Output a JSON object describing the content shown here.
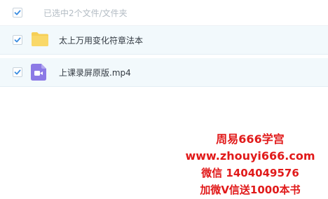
{
  "header": {
    "selection_text": "已选中2个文件/文件夹"
  },
  "files": [
    {
      "name": "太上万用变化符章法本",
      "icon": "folder-icon",
      "checked": true
    },
    {
      "name": "上课录屏原版.mp4",
      "icon": "video-icon",
      "checked": true
    }
  ],
  "promo": {
    "line1": "周易666学宫",
    "line2": "www.zhouyi666.com",
    "line3": "微信 1404049576",
    "line4": "加微V信送1000本书"
  },
  "colors": {
    "check": "#3b8de0",
    "folder": "#f6cf56",
    "video": "#8c7ae6",
    "promo": "#e11a1a"
  }
}
